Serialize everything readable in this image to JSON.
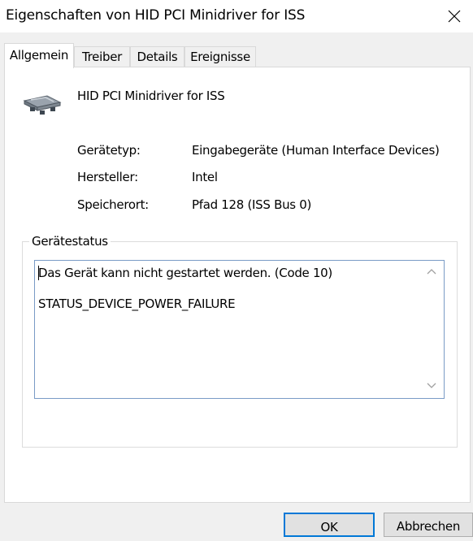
{
  "window": {
    "title": "Eigenschaften von HID PCI Minidriver for ISS",
    "close_icon": "close-icon"
  },
  "tabs": [
    {
      "label": "Allgemein",
      "active": true
    },
    {
      "label": "Treiber",
      "active": false
    },
    {
      "label": "Details",
      "active": false
    },
    {
      "label": "Ereignisse",
      "active": false
    }
  ],
  "general": {
    "device_icon": "hid-device-icon",
    "device_name": "HID PCI Minidriver for ISS",
    "properties": [
      {
        "label": "Gerätetyp:",
        "value": "Eingabegeräte (Human Interface Devices)"
      },
      {
        "label": "Hersteller:",
        "value": "Intel"
      },
      {
        "label": "Speicherort:",
        "value": "Pfad 128 (ISS Bus 0)"
      }
    ],
    "status_group": {
      "legend": "Gerätestatus",
      "lines": [
        "Das Gerät kann nicht gestartet werden. (Code 10)",
        "STATUS_DEVICE_POWER_FAILURE"
      ]
    }
  },
  "buttons": {
    "ok": "OK",
    "cancel": "Abbrechen"
  },
  "colors": {
    "accent": "#0078d7",
    "status_border": "#7a9bc6"
  }
}
